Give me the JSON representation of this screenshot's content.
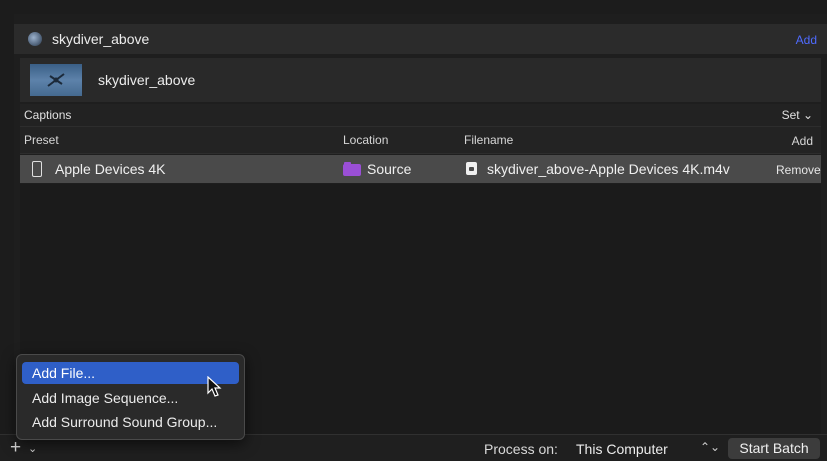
{
  "job": {
    "title": "skydiver_above",
    "add_label": "Add"
  },
  "source": {
    "name": "skydiver_above"
  },
  "captions": {
    "label": "Captions",
    "set_label": "Set ⌄"
  },
  "columns": {
    "preset": "Preset",
    "location": "Location",
    "filename": "Filename",
    "add_label": "Add"
  },
  "output": {
    "preset": "Apple Devices 4K",
    "location": "Source",
    "filename": "skydiver_above-Apple Devices 4K.m4v",
    "remove_label": "Remove"
  },
  "menu": {
    "items": [
      {
        "label": "Add File..."
      },
      {
        "label": "Add Image Sequence..."
      },
      {
        "label": "Add Surround Sound Group..."
      }
    ]
  },
  "bottom": {
    "plus": "+",
    "chevron": "⌄",
    "process_label": "Process on:",
    "process_value": "This Computer",
    "updown": "⌃⌄",
    "start_label": "Start Batch"
  },
  "colors": {
    "accent_link": "#4f6bff",
    "selection": "#2f5fc8",
    "folder": "#9a4fd6"
  }
}
